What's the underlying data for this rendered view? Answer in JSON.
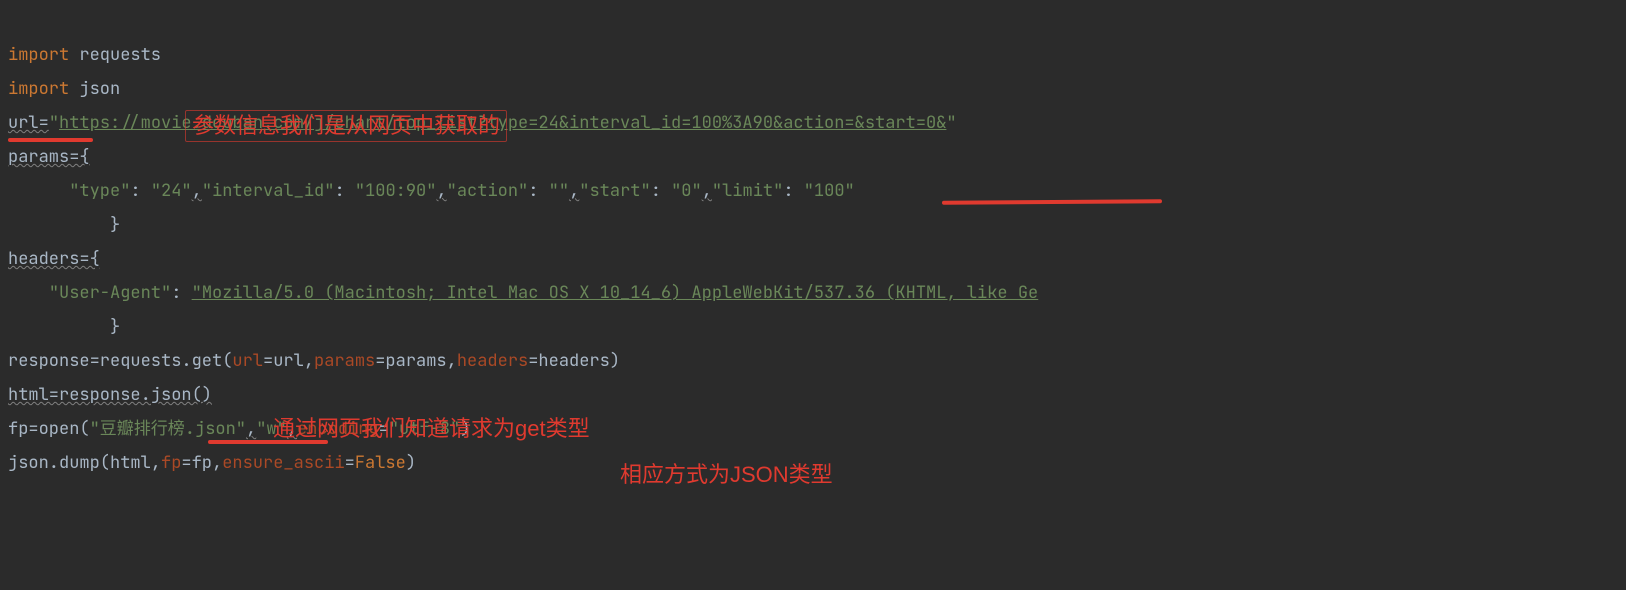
{
  "code": {
    "l1_kw": "import",
    "l1_mod": " requests",
    "l2_kw": "import",
    "l2_mod": " json",
    "l3_a": "url=",
    "l3_q1": "\"",
    "l3_url": "https://movie.douban.com/j/chart/top_list?type=24&interval_id=100%3A90&action=&start=0&",
    "l3_q2": "\"",
    "l4_a": "params={",
    "l5_indent": "      ",
    "l5_k1": "\"type\"",
    "l5_c1": ": ",
    "l5_v1": "\"24\"",
    "l5_s1": ",",
    "l5_k2": "\"interval_id\"",
    "l5_c2": ": ",
    "l5_v2": "\"100:90\"",
    "l5_s2": ",",
    "l5_k3": "\"action\"",
    "l5_c3": ": ",
    "l5_v3": "\"\"",
    "l5_s3": ",",
    "l5_k4": "\"start\"",
    "l5_c4": ": ",
    "l5_v4": "\"0\"",
    "l5_s4": ",",
    "l5_k5": "\"limit\"",
    "l5_c5": ": ",
    "l5_v5": "\"100\"",
    "l6_indent": "          ",
    "l6_brace": "}",
    "l7_a": "headers={",
    "l8_indent": "    ",
    "l8_k": "\"User-Agent\"",
    "l8_c": ": ",
    "l8_v": "\"Mozilla/5.0 (Macintosh; Intel Mac OS X 10_14_6) AppleWebKit/537.36 (KHTML, like Ge",
    "l9_indent": "          ",
    "l9_brace": "}",
    "l10_a": "response=requests.get(",
    "l10_k1": "url",
    "l10_e1": "=url,",
    "l10_k2": "params",
    "l10_e2": "=params,",
    "l10_k3": "headers",
    "l10_e3": "=headers)",
    "l11_a": "html=response.json()",
    "l12_a": "fp=open(",
    "l12_s1": "\"豆瓣排行榜.json\"",
    "l12_c1": ",",
    "l12_s2": "\"w\"",
    "l12_c2": ",",
    "l12_k": "encoding",
    "l12_e": "=",
    "l12_s3": "\"utf-8\"",
    "l12_close": ")",
    "l13_a": "json.dump(html,",
    "l13_k1": "fp",
    "l13_e1": "=fp,",
    "l13_k2": "ensure_ascii",
    "l13_e2": "=",
    "l13_v": "False",
    "l13_close": ")"
  },
  "annotations": {
    "a1": "参数信息我们是从网页中获取的",
    "a2": "通过网页我们知道请求为get类型",
    "a3": "相应方式为JSON类型"
  }
}
